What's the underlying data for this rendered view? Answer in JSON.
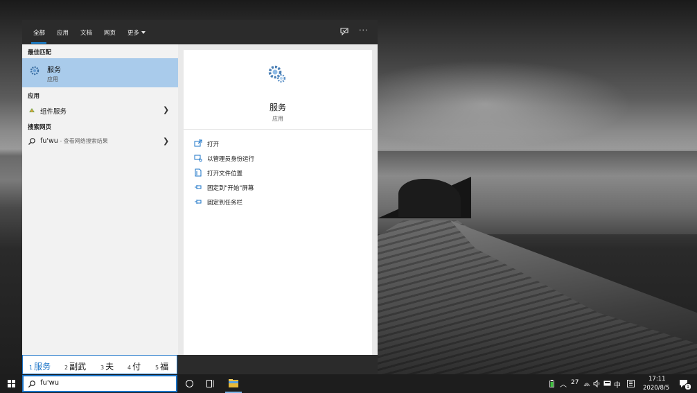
{
  "search_panel": {
    "tabs": [
      {
        "label": "全部",
        "active": true
      },
      {
        "label": "应用"
      },
      {
        "label": "文档"
      },
      {
        "label": "网页"
      },
      {
        "label": "更多"
      }
    ],
    "toolbar_icons": [
      "feedback-icon",
      "more-options-icon"
    ],
    "more_options_glyph": "···",
    "left": {
      "best_match_header": "最佳匹配",
      "best_match": {
        "title": "服务",
        "subtitle": "应用",
        "icon": "gear-services-icon"
      },
      "apps_header": "应用",
      "apps": [
        {
          "label": "组件服务",
          "icon": "component-services-icon"
        }
      ],
      "web_header": "搜索网页",
      "web": [
        {
          "query": "fu'wu",
          "suffix": " - 查看网络搜索结果",
          "icon": "search-icon"
        }
      ]
    },
    "right": {
      "title": "服务",
      "subtitle": "应用",
      "actions": [
        {
          "label": "打开",
          "icon": "open-icon"
        },
        {
          "label": "以管理员身份运行",
          "icon": "run-as-admin-icon"
        },
        {
          "label": "打开文件位置",
          "icon": "file-location-icon"
        },
        {
          "label": "固定到\"开始\"屏幕",
          "icon": "pin-icon"
        },
        {
          "label": "固定到任务栏",
          "icon": "pin-icon"
        }
      ]
    }
  },
  "ime": {
    "candidates": [
      {
        "num": "1",
        "text": "服务",
        "active": true
      },
      {
        "num": "2",
        "text": "副武"
      },
      {
        "num": "3",
        "text": "夫"
      },
      {
        "num": "4",
        "text": "付"
      },
      {
        "num": "5",
        "text": "福"
      }
    ]
  },
  "taskbar": {
    "search_value": "fu'wu",
    "tray": {
      "temperature": "27",
      "ime_mode": "中",
      "time": "17:11",
      "date": "2020/8/5",
      "notification_count": "1"
    }
  },
  "colors": {
    "accent": "#1a73c7",
    "selection": "#a9cbeb"
  }
}
